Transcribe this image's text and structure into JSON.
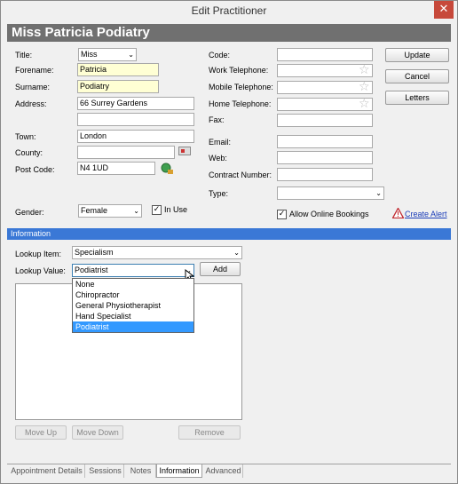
{
  "window": {
    "title": "Edit Practitioner",
    "close_glyph": "✕"
  },
  "header": {
    "title": "Miss Patricia Podiatry"
  },
  "labels": {
    "title": "Title:",
    "forename": "Forename:",
    "surname": "Surname:",
    "address": "Address:",
    "town": "Town:",
    "county": "County:",
    "postcode": "Post Code:",
    "gender": "Gender:",
    "code": "Code:",
    "work_tel": "Work Telephone:",
    "mobile_tel": "Mobile Telephone:",
    "home_tel": "Home Telephone:",
    "fax": "Fax:",
    "email": "Email:",
    "web": "Web:",
    "contract": "Contract Number:",
    "type": "Type:"
  },
  "fields": {
    "title": "Miss",
    "forename": "Patricia",
    "surname": "Podiatry",
    "address1": "66 Surrey Gardens",
    "address2": "",
    "town": "London",
    "county": "",
    "postcode": "N4 1UD",
    "gender": "Female",
    "code": "",
    "work_tel": "",
    "mobile_tel": "",
    "home_tel": "",
    "fax": "",
    "email": "",
    "web": "",
    "contract": "",
    "type": ""
  },
  "checkboxes": {
    "in_use": "In Use",
    "allow_online": "Allow Online Bookings",
    "check_glyph": "✓"
  },
  "buttons": {
    "update": "Update",
    "cancel": "Cancel",
    "letters": "Letters",
    "add": "Add",
    "move_up": "Move Up",
    "move_down": "Move Down",
    "remove": "Remove"
  },
  "alert": {
    "label": "Create Alert",
    "icon_glyph": "!"
  },
  "info": {
    "header": "Information",
    "lookup_item_label": "Lookup Item:",
    "lookup_item_value": "Specialism",
    "lookup_value_label": "Lookup Value:",
    "lookup_value_value": "Podiatrist",
    "dropdown_options": [
      "None",
      "Chiropractor",
      "General Physiotherapist",
      "Hand Specialist",
      "Podiatrist"
    ],
    "selected_option": "Podiatrist"
  },
  "tabs": [
    "Appointment Details",
    "Sessions",
    "Notes",
    "Information",
    "Advanced"
  ],
  "active_tab": "Information",
  "icons": {
    "arrow": "⌄",
    "star": "☆"
  },
  "colors": {
    "header_bg": "#707070",
    "info_bar": "#3a78d6",
    "selection": "#3399ff",
    "close": "#c7493b"
  }
}
